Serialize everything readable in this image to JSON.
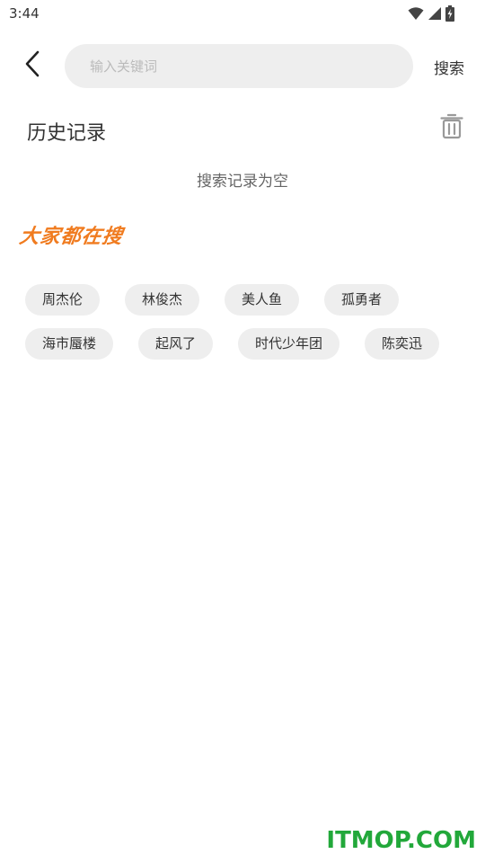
{
  "status_bar": {
    "time": "3:44",
    "icons": [
      "wifi-icon",
      "cell-signal-icon",
      "battery-charging-icon"
    ]
  },
  "header": {
    "back_icon": "chevron-left-icon",
    "search_placeholder": "输入关键词",
    "search_value": "",
    "search_label": "搜索"
  },
  "history": {
    "title": "历史记录",
    "clear_icon": "trash-icon",
    "empty_text": "搜索记录为空"
  },
  "hot": {
    "title": "大家都在搜",
    "title_color": "#f07b1f",
    "rows": [
      [
        "周杰伦",
        "林俊杰",
        "美人鱼",
        "孤勇者"
      ],
      [
        "海市蜃楼",
        "起风了",
        "时代少年团",
        "陈奕迅"
      ]
    ]
  },
  "watermark": {
    "text": "ITMOP.COM",
    "color": "#22a83a"
  }
}
